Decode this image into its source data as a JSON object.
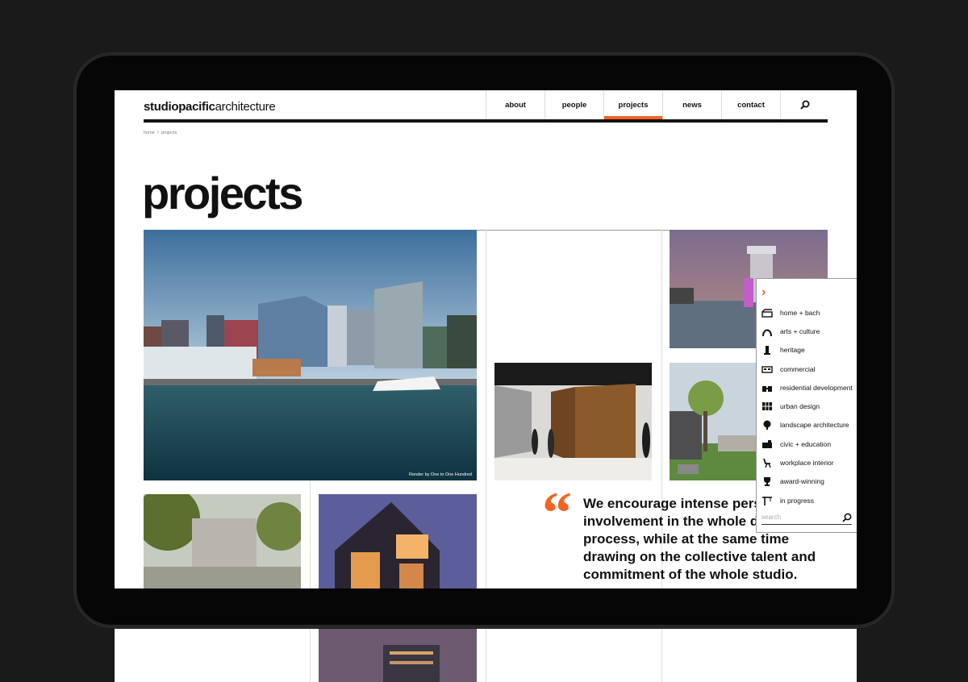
{
  "site": {
    "logo_bold": "studiopacific",
    "logo_light": "architecture"
  },
  "nav": {
    "items": [
      {
        "label": "about",
        "active": false
      },
      {
        "label": "people",
        "active": false
      },
      {
        "label": "projects",
        "active": true
      },
      {
        "label": "news",
        "active": false
      },
      {
        "label": "contact",
        "active": false
      }
    ],
    "search_icon": "search-icon"
  },
  "breadcrumb": {
    "home": "home",
    "current": "projects"
  },
  "page": {
    "title": "projects"
  },
  "tiles": {
    "main_caption": "Render by One to One Hundred"
  },
  "quote": {
    "text": "We encourage intense personal\ninvolvement in the whole design\nprocess, while at the same time\ndrawing on the collective talent and\ncommitment of the whole studio."
  },
  "filter": {
    "toggle_icon": "chevron-right-icon",
    "items": [
      {
        "label": "home + bach",
        "icon": "house-icon"
      },
      {
        "label": "arts + culture",
        "icon": "arch-icon"
      },
      {
        "label": "heritage",
        "icon": "column-icon"
      },
      {
        "label": "commercial",
        "icon": "building-icon"
      },
      {
        "label": "residential development",
        "icon": "houses-icon"
      },
      {
        "label": "urban design",
        "icon": "grid-icon"
      },
      {
        "label": "landscape architecture",
        "icon": "tree-icon"
      },
      {
        "label": "civic + education",
        "icon": "flag-icon"
      },
      {
        "label": "workplace interior",
        "icon": "chair-icon"
      },
      {
        "label": "award-winning",
        "icon": "trophy-icon"
      },
      {
        "label": "in progress",
        "icon": "crane-icon"
      }
    ],
    "search_placeholder": "search"
  },
  "colors": {
    "accent": "#f26522",
    "text": "#111111",
    "background": "#1a1a1a"
  }
}
